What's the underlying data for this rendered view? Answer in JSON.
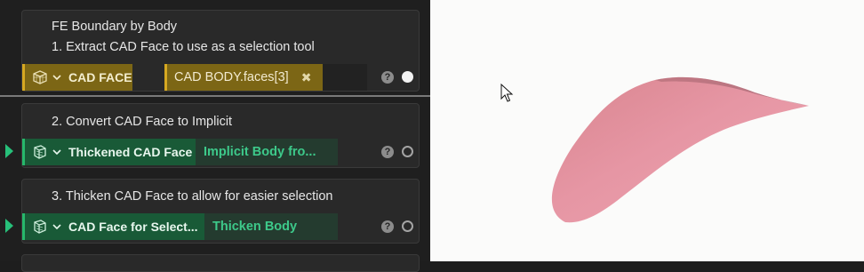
{
  "steps": [
    {
      "titles": [
        "FE Boundary by Body",
        "1. Extract CAD Face to use as a selection tool"
      ],
      "chip": {
        "label": "CAD FACE",
        "icon": "cad-face-icon"
      },
      "reference": {
        "label": "CAD BODY.faces[3]",
        "remove_symbol": "✖"
      },
      "help": "?"
    },
    {
      "titles": [
        "2. Convert CAD Face to Implicit"
      ],
      "chip": {
        "label": "Thickened CAD Face",
        "icon": "implicit-body-icon"
      },
      "reference": {
        "label": "Implicit Body fro..."
      },
      "help": "?"
    },
    {
      "titles": [
        "3. Thicken CAD Face to allow for easier selection"
      ],
      "chip": {
        "label": "CAD Face for Select...",
        "icon": "implicit-body-icon"
      },
      "reference": {
        "label": "Thicken Body"
      },
      "help": "?"
    }
  ],
  "colors": {
    "cad_accent": "#d6a821",
    "implicit_accent": "#26b86b",
    "surface_pink": "#e8909f",
    "viewport_bg": "#fbfbfa"
  }
}
